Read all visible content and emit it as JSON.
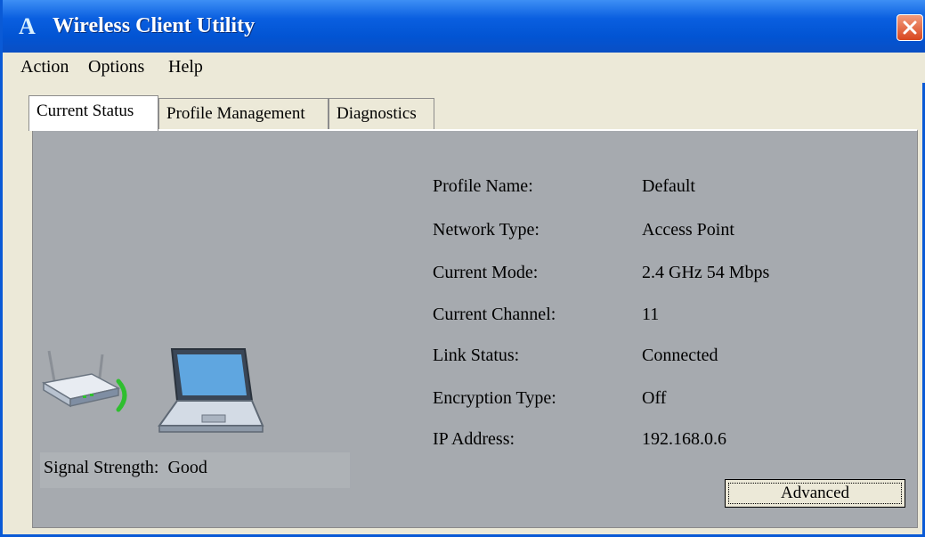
{
  "window": {
    "title": "Wireless Client Utility",
    "icon_letter": "A",
    "close_icon": "close-x-icon"
  },
  "menu": {
    "items": [
      "Action",
      "Options",
      "Help"
    ]
  },
  "tabs": [
    {
      "label": "Current Status",
      "active": true
    },
    {
      "label": "Profile Management",
      "active": false
    },
    {
      "label": "Diagnostics",
      "active": false
    }
  ],
  "status": {
    "rows": [
      {
        "label": "Profile Name:",
        "value": "Default"
      },
      {
        "label": "Network Type:",
        "value": "Access Point"
      },
      {
        "label": "Current Mode:",
        "value": "2.4 GHz 54 Mbps"
      },
      {
        "label": "Current Channel:",
        "value": "11"
      },
      {
        "label": "Link Status:",
        "value": "Connected"
      },
      {
        "label": "Encryption Type:",
        "value": "Off"
      },
      {
        "label": "IP Address:",
        "value": "192.168.0.6"
      }
    ],
    "signal_label": "Signal Strength:",
    "signal_value": "Good",
    "advanced_label": "Advanced"
  },
  "illustration": {
    "router_icon": "wireless-router-icon",
    "wave_icon": "signal-wave-icon",
    "laptop_icon": "laptop-icon",
    "wave_color": "#2fbf2f"
  }
}
